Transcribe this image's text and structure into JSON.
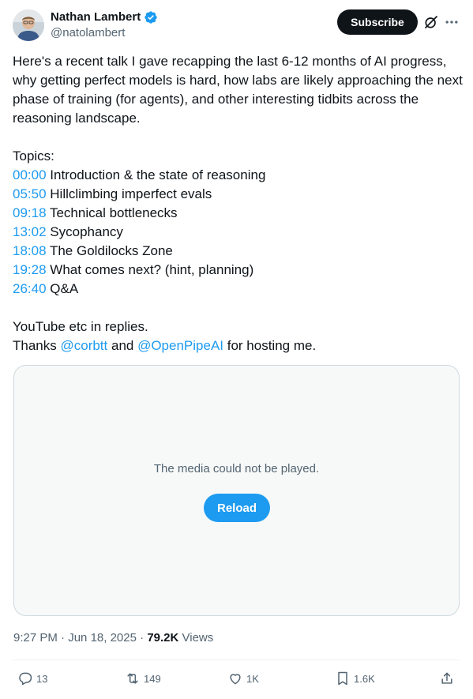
{
  "author": {
    "name": "Nathan Lambert",
    "handle": "@natolambert",
    "verified_color": "#1d9bf0"
  },
  "header": {
    "subscribe_label": "Subscribe",
    "icons": [
      "grok-icon",
      "more-icon"
    ]
  },
  "post": {
    "intro": "Here's a recent talk I gave recapping the last 6-12 months of AI progress, why getting perfect models is hard, how labs are likely approaching the next phase of training (for agents), and other interesting tidbits across the reasoning landscape.",
    "topics_heading": "Topics:",
    "topics": [
      {
        "time": "00:00",
        "title": "Introduction & the state of reasoning"
      },
      {
        "time": "05:50",
        "title": "Hillclimbing imperfect evals"
      },
      {
        "time": "09:18",
        "title": "Technical bottlenecks"
      },
      {
        "time": "13:02",
        "title": "Sycophancy"
      },
      {
        "time": "18:08",
        "title": "The Goldilocks Zone"
      },
      {
        "time": "19:28",
        "title": "What comes next? (hint, planning)"
      },
      {
        "time": "26:40",
        "title": "Q&A"
      }
    ],
    "replies_line": "YouTube etc in replies.",
    "thanks_prefix": "Thanks ",
    "mention_1": "@corbtt",
    "thanks_middle": " and ",
    "mention_2": "@OpenPipeAI",
    "thanks_suffix": " for hosting me."
  },
  "media": {
    "message": "The media could not be played.",
    "reload_label": "Reload"
  },
  "meta": {
    "time": "9:27 PM",
    "separator": " · ",
    "date": "Jun 18, 2025",
    "views_count": "79.2K",
    "views_label": " Views"
  },
  "actions": {
    "replies": "13",
    "reposts": "149",
    "likes": "1K",
    "bookmarks": "1.6K"
  },
  "colors": {
    "link": "#1d9bf0",
    "text": "#0f1419",
    "muted": "#536471",
    "border": "#cfd9de"
  }
}
